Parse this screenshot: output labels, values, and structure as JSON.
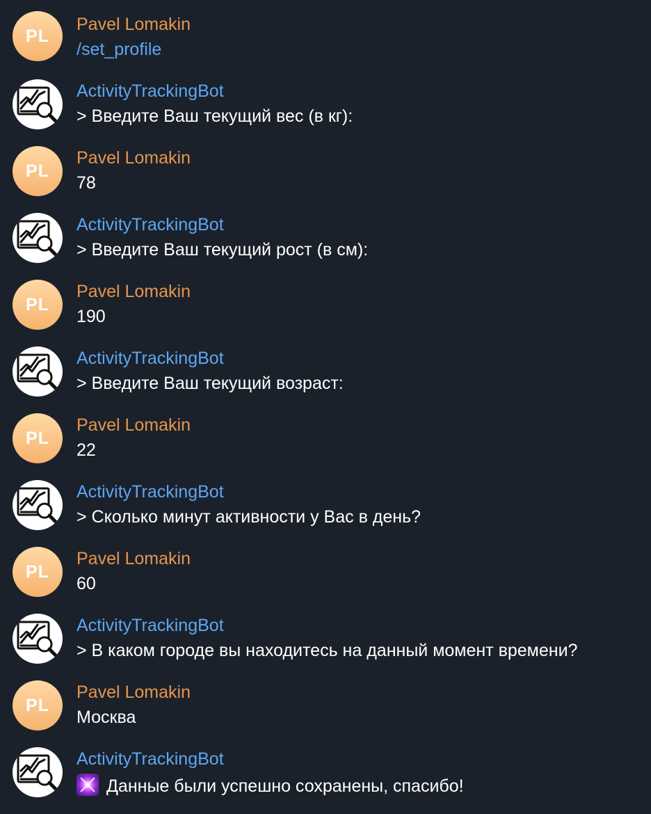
{
  "messages": [
    {
      "sender": "Pavel Lomakin",
      "initials": "PL",
      "text": "/set_profile"
    },
    {
      "sender": "ActivityTrackingBot",
      "text": "> Введите Ваш текущий вес (в кг):"
    },
    {
      "sender": "Pavel Lomakin",
      "initials": "PL",
      "text": "78"
    },
    {
      "sender": "ActivityTrackingBot",
      "text": "> Введите Ваш текущий рост (в см):"
    },
    {
      "sender": "Pavel Lomakin",
      "initials": "PL",
      "text": "190"
    },
    {
      "sender": "ActivityTrackingBot",
      "text": "> Введите Ваш текущий возраст:"
    },
    {
      "sender": "Pavel Lomakin",
      "initials": "PL",
      "text": "22"
    },
    {
      "sender": "ActivityTrackingBot",
      "text": "> Сколько минут активности у Вас в день?"
    },
    {
      "sender": "Pavel Lomakin",
      "initials": "PL",
      "text": "60"
    },
    {
      "sender": "ActivityTrackingBot",
      "text": "> В каком городе вы находитесь на данный момент времени?"
    },
    {
      "sender": "Pavel Lomakin",
      "initials": "PL",
      "text": "Москва"
    },
    {
      "sender": "ActivityTrackingBot",
      "emoji": "sparkle-emoji",
      "text": "Данные были успешно сохранены, спасибо!"
    }
  ],
  "colors": {
    "background": "#1b212b",
    "user_name": "#e6954c",
    "bot_name": "#5ea6f0",
    "message_text": "#ffffff",
    "command_link": "#5ea6f0",
    "user_avatar": "#f6b36f"
  },
  "icons": {
    "bot_avatar": "chart-magnifier-icon"
  }
}
